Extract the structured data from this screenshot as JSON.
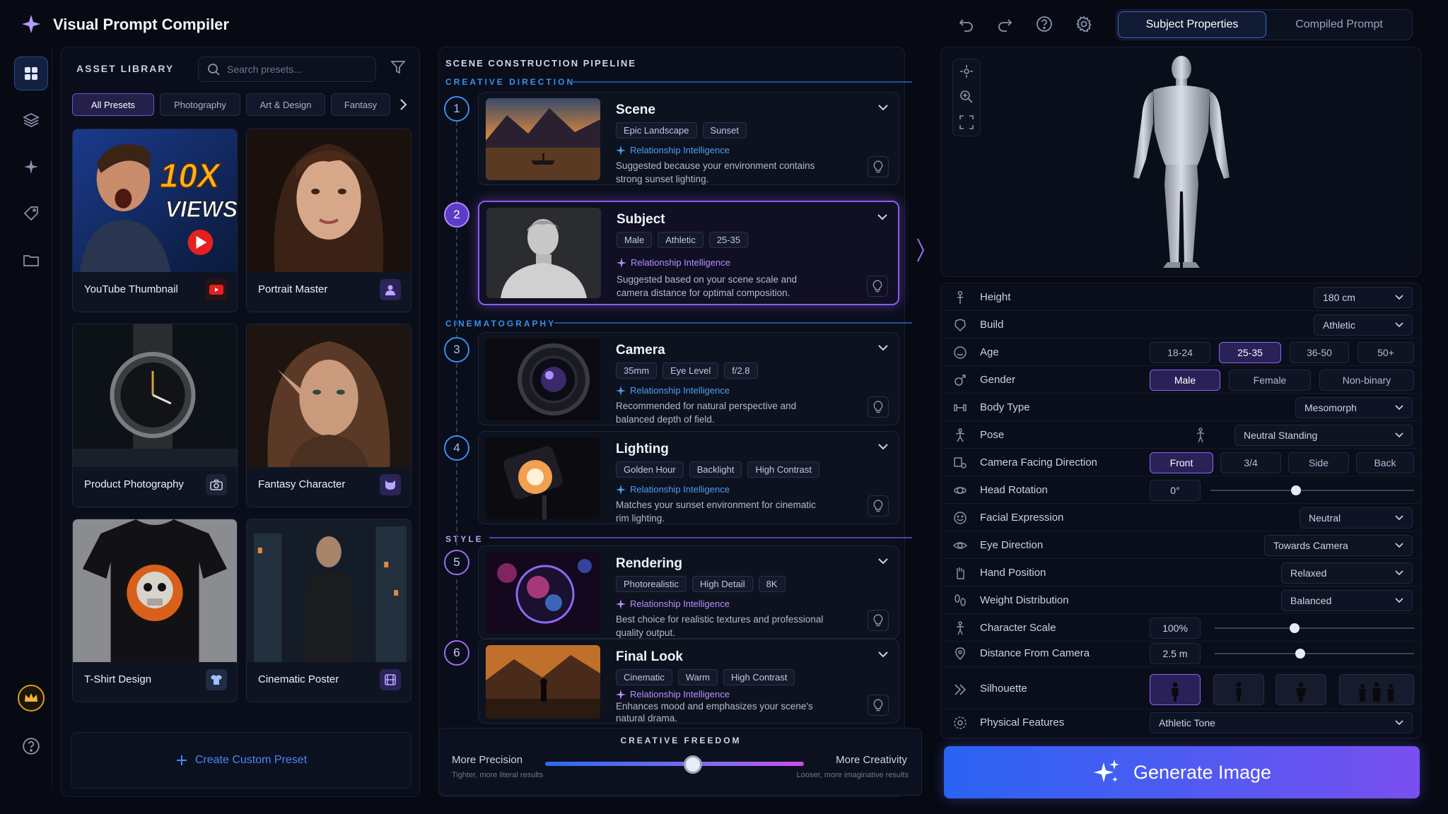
{
  "app": {
    "title": "Visual Prompt Compiler"
  },
  "header": {
    "tabs": [
      {
        "label": "Subject Properties",
        "active": true
      },
      {
        "label": "Compiled Prompt",
        "active": false
      }
    ]
  },
  "library": {
    "title": "ASSET LIBRARY",
    "search_placeholder": "Search presets...",
    "chips": [
      "All Presets",
      "Photography",
      "Art & Design",
      "Fantasy"
    ],
    "cards": [
      {
        "label": "YouTube Thumbnail",
        "icon": "youtube-icon",
        "overlay_top": "10X",
        "overlay_bottom": "VIEWS"
      },
      {
        "label": "Portrait Master",
        "icon": "person-icon"
      },
      {
        "label": "Product Photography",
        "icon": "camera-icon"
      },
      {
        "label": "Fantasy Character",
        "icon": "mask-icon"
      },
      {
        "label": "T-Shirt Design",
        "icon": "shirt-icon"
      },
      {
        "label": "Cinematic Poster",
        "icon": "film-icon"
      }
    ],
    "create_label": "Create Custom Preset"
  },
  "pipeline": {
    "title": "SCENE CONSTRUCTION PIPELINE",
    "groups": {
      "creative": "CREATIVE DIRECTION",
      "cinematography": "CINEMATOGRAPHY",
      "style": "STYLE"
    },
    "ri_label": "Relationship Intelligence",
    "steps": [
      {
        "num": "1",
        "title": "Scene",
        "tags": [
          "Epic Landscape",
          "Sunset"
        ],
        "desc": "Suggested because your environment contains strong sunset lighting."
      },
      {
        "num": "2",
        "title": "Subject",
        "tags": [
          "Male",
          "Athletic",
          "25-35"
        ],
        "desc": "Suggested based on your scene scale and camera distance for optimal composition."
      },
      {
        "num": "3",
        "title": "Camera",
        "tags": [
          "35mm",
          "Eye Level",
          "f/2.8"
        ],
        "desc": "Recommended for natural perspective and balanced depth of field."
      },
      {
        "num": "4",
        "title": "Lighting",
        "tags": [
          "Golden Hour",
          "Backlight",
          "High Contrast"
        ],
        "desc": "Matches your sunset environment for cinematic rim lighting."
      },
      {
        "num": "5",
        "title": "Rendering",
        "tags": [
          "Photorealistic",
          "High Detail",
          "8K"
        ],
        "desc": "Best choice for realistic textures and professional quality output."
      },
      {
        "num": "6",
        "title": "Final Look",
        "tags": [
          "Cinematic",
          "Warm",
          "High Contrast"
        ],
        "desc": "Enhances mood and emphasizes your scene's natural drama."
      }
    ],
    "freedom": {
      "title": "CREATIVE FREEDOM",
      "left": "More Precision",
      "left_sub": "Tighter, more literal results",
      "right": "More Creativity",
      "right_sub": "Looser, more imaginative results",
      "value": 0.57
    }
  },
  "props": {
    "height": {
      "label": "Height",
      "value": "180 cm"
    },
    "build": {
      "label": "Build",
      "value": "Athletic"
    },
    "age": {
      "label": "Age",
      "options": [
        "18-24",
        "25-35",
        "36-50",
        "50+"
      ],
      "selected": "25-35"
    },
    "gender": {
      "label": "Gender",
      "options": [
        "Male",
        "Female",
        "Non-binary"
      ],
      "selected": "Male"
    },
    "body_type": {
      "label": "Body Type",
      "value": "Mesomorph"
    },
    "pose": {
      "label": "Pose",
      "value": "Neutral Standing"
    },
    "facing": {
      "label": "Camera Facing Direction",
      "options": [
        "Front",
        "3/4",
        "Side",
        "Back"
      ],
      "selected": "Front"
    },
    "head_rotation": {
      "label": "Head Rotation",
      "value": "0°",
      "level": 0.42
    },
    "facial_expression": {
      "label": "Facial Expression",
      "value": "Neutral"
    },
    "eye_direction": {
      "label": "Eye Direction",
      "value": "Towards Camera"
    },
    "hand_position": {
      "label": "Hand Position",
      "value": "Relaxed"
    },
    "weight_distribution": {
      "label": "Weight Distribution",
      "value": "Balanced"
    },
    "character_scale": {
      "label": "Character Scale",
      "value": "100%",
      "level": 0.4
    },
    "distance": {
      "label": "Distance From Camera",
      "value": "2.5 m",
      "level": 0.43
    },
    "silhouette": {
      "label": "Silhouette",
      "selected_index": 0
    },
    "physical": {
      "label": "Physical Features",
      "value": "Athletic Tone"
    }
  },
  "generate_label": "Generate Image",
  "colors": {
    "accent_blue": "#3a8ef0",
    "accent_purple": "#8a5cf0",
    "bg": "#070a13"
  }
}
